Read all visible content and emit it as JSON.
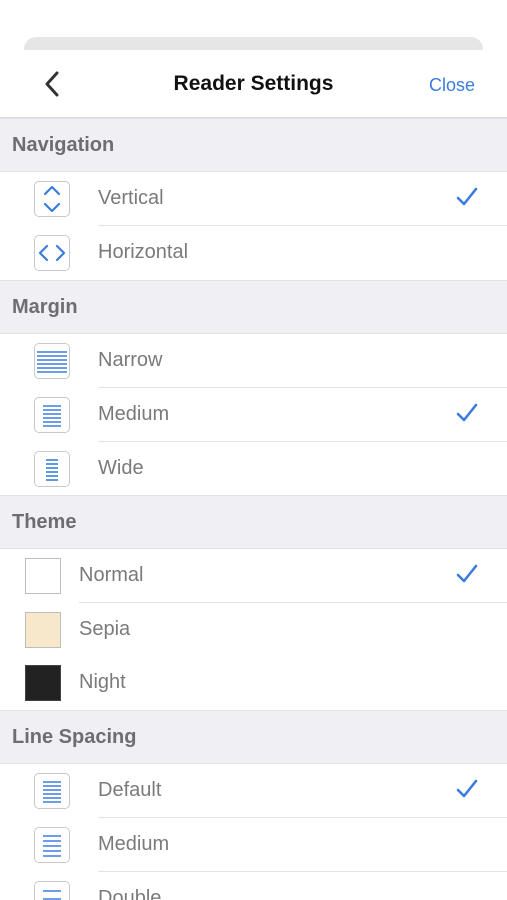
{
  "header": {
    "title": "Reader Settings",
    "close_label": "Close",
    "back_icon": "chevron-left-icon"
  },
  "colors": {
    "accent": "#3b7ddd",
    "section_bg": "#efeff4",
    "sepia": "#f7e8cc",
    "night": "#222222",
    "normal": "#ffffff"
  },
  "sections": {
    "navigation": {
      "title": "Navigation",
      "items": [
        {
          "label": "Vertical",
          "icon": "vertical-arrows-icon",
          "selected": true
        },
        {
          "label": "Horizontal",
          "icon": "horizontal-arrows-icon",
          "selected": false
        }
      ]
    },
    "margin": {
      "title": "Margin",
      "items": [
        {
          "label": "Narrow",
          "icon": "margin-narrow-icon",
          "selected": false
        },
        {
          "label": "Medium",
          "icon": "margin-medium-icon",
          "selected": true
        },
        {
          "label": "Wide",
          "icon": "margin-wide-icon",
          "selected": false
        }
      ]
    },
    "theme": {
      "title": "Theme",
      "items": [
        {
          "label": "Normal",
          "icon": "theme-normal-swatch",
          "selected": true
        },
        {
          "label": "Sepia",
          "icon": "theme-sepia-swatch",
          "selected": false
        },
        {
          "label": "Night",
          "icon": "theme-night-swatch",
          "selected": false
        }
      ]
    },
    "line_spacing": {
      "title": "Line Spacing",
      "items": [
        {
          "label": "Default",
          "icon": "spacing-default-icon",
          "selected": true
        },
        {
          "label": "Medium",
          "icon": "spacing-medium-icon",
          "selected": false
        },
        {
          "label": "Double",
          "icon": "spacing-double-icon",
          "selected": false
        }
      ]
    }
  }
}
